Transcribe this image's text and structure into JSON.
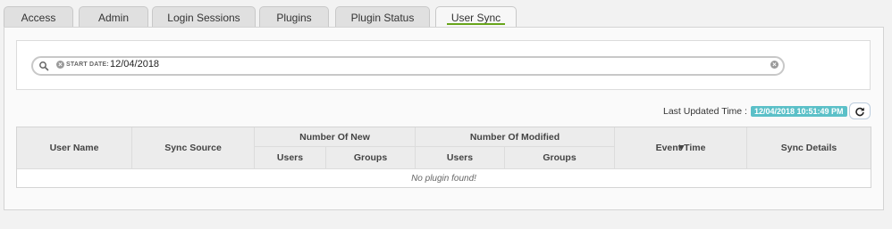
{
  "tabs": [
    {
      "label": "Access"
    },
    {
      "label": "Admin"
    },
    {
      "label": "Login Sessions"
    },
    {
      "label": "Plugins"
    },
    {
      "label": "Plugin Status"
    },
    {
      "label": "User Sync",
      "active": true
    }
  ],
  "search": {
    "icon": "search-icon",
    "filter_label": "START DATE:",
    "filter_value": "12/04/2018"
  },
  "status": {
    "last_updated_label": "Last Updated Time :",
    "last_updated_value": "12/04/2018 10:51:49 PM",
    "refresh_icon": "refresh-icon"
  },
  "table": {
    "columns": {
      "user_name": "User Name",
      "sync_source": "Sync Source",
      "number_of_new": "Number Of New",
      "number_of_modified": "Number Of Modified",
      "new_users": "Users",
      "new_groups": "Groups",
      "mod_users": "Users",
      "mod_groups": "Groups",
      "event_time": "Event Time",
      "sync_details": "Sync Details"
    },
    "sort_indicator": "▼",
    "empty_message": "No plugin found!"
  },
  "colors": {
    "active_tab_underline": "#67a51b",
    "timestamp_badge": "#5bc0c8"
  }
}
